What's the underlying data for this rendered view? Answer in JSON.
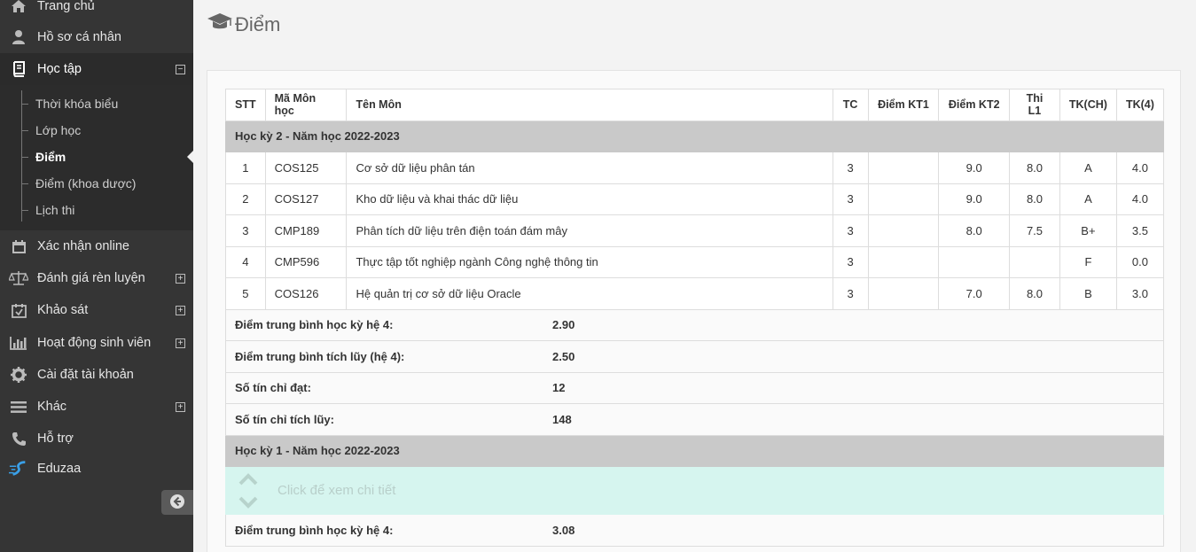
{
  "sidebar": {
    "items": [
      {
        "label": "Trang chủ",
        "icon": "home-icon"
      },
      {
        "label": "Hồ sơ cá nhân",
        "icon": "user-icon"
      },
      {
        "label": "Học tập",
        "icon": "book-icon",
        "toggle": "⊟"
      },
      {
        "label": "Xác nhận online",
        "icon": "calendar-icon"
      },
      {
        "label": "Đánh giá rèn luyện",
        "icon": "scale-icon",
        "toggle": "⊞"
      },
      {
        "label": "Khảo sát",
        "icon": "calendar-check-icon",
        "toggle": "⊞"
      },
      {
        "label": "Hoạt động sinh viên",
        "icon": "bar-chart-icon",
        "toggle": "⊞"
      },
      {
        "label": "Cài đặt tài khoản",
        "icon": "gear-icon"
      },
      {
        "label": "Khác",
        "icon": "menu-icon",
        "toggle": "⊞"
      },
      {
        "label": "Hỗ trợ",
        "icon": "phone-icon"
      },
      {
        "label": "Eduzaa",
        "icon": "eduzaa-logo-icon"
      }
    ],
    "subitems": [
      {
        "label": "Thời khóa biểu"
      },
      {
        "label": "Lớp học"
      },
      {
        "label": "Điểm"
      },
      {
        "label": "Điểm (khoa dược)"
      },
      {
        "label": "Lịch thi"
      }
    ]
  },
  "page": {
    "title": "Điểm"
  },
  "table": {
    "headers": [
      "STT",
      "Mã Môn học",
      "Tên Môn",
      "TC",
      "Điểm KT1",
      "Điểm KT2",
      "Thi L1",
      "TK(CH)",
      "TK(4)"
    ],
    "semester1": {
      "title": "Học kỳ 2 - Năm học 2022-2023",
      "rows": [
        {
          "stt": "1",
          "code": "COS125",
          "name": "Cơ sở dữ liệu phân tán",
          "tc": "3",
          "kt1": "",
          "kt2": "9.0",
          "thi": "8.0",
          "tkch": "A",
          "tk4": "4.0"
        },
        {
          "stt": "2",
          "code": "COS127",
          "name": "Kho dữ liệu và khai thác dữ liệu",
          "tc": "3",
          "kt1": "",
          "kt2": "9.0",
          "thi": "8.0",
          "tkch": "A",
          "tk4": "4.0"
        },
        {
          "stt": "3",
          "code": "CMP189",
          "name": "Phân tích dữ liệu trên điện toán đám mây",
          "tc": "3",
          "kt1": "",
          "kt2": "8.0",
          "thi": "7.5",
          "tkch": "B+",
          "tk4": "3.5"
        },
        {
          "stt": "4",
          "code": "CMP596",
          "name": "Thực tập tốt nghiệp ngành Công nghệ thông tin",
          "tc": "3",
          "kt1": "",
          "kt2": "",
          "thi": "",
          "tkch": "F",
          "tk4": "0.0"
        },
        {
          "stt": "5",
          "code": "COS126",
          "name": "Hệ quản trị cơ sở dữ liệu Oracle",
          "tc": "3",
          "kt1": "",
          "kt2": "7.0",
          "thi": "8.0",
          "tkch": "B",
          "tk4": "3.0"
        }
      ],
      "summary": [
        {
          "label": "Điểm trung bình học kỳ hệ 4:",
          "value": "2.90"
        },
        {
          "label": "Điểm trung bình tích lũy (hệ 4):",
          "value": "2.50"
        },
        {
          "label": "Số tín chỉ đạt:",
          "value": "12"
        },
        {
          "label": "Số tín chỉ tích lũy:",
          "value": "148"
        }
      ]
    },
    "semester2": {
      "title": "Học kỳ 1 - Năm học 2022-2023",
      "toggle_label": "Click để xem chi tiết",
      "summary": [
        {
          "label": "Điểm trung bình học kỳ hệ 4:",
          "value": "3.08"
        }
      ]
    }
  },
  "colors": {
    "sidebar_bg": "#353535",
    "semester_header_bg": "#c9c9c9",
    "collapsed_row_bg": "#d6f5ef"
  }
}
